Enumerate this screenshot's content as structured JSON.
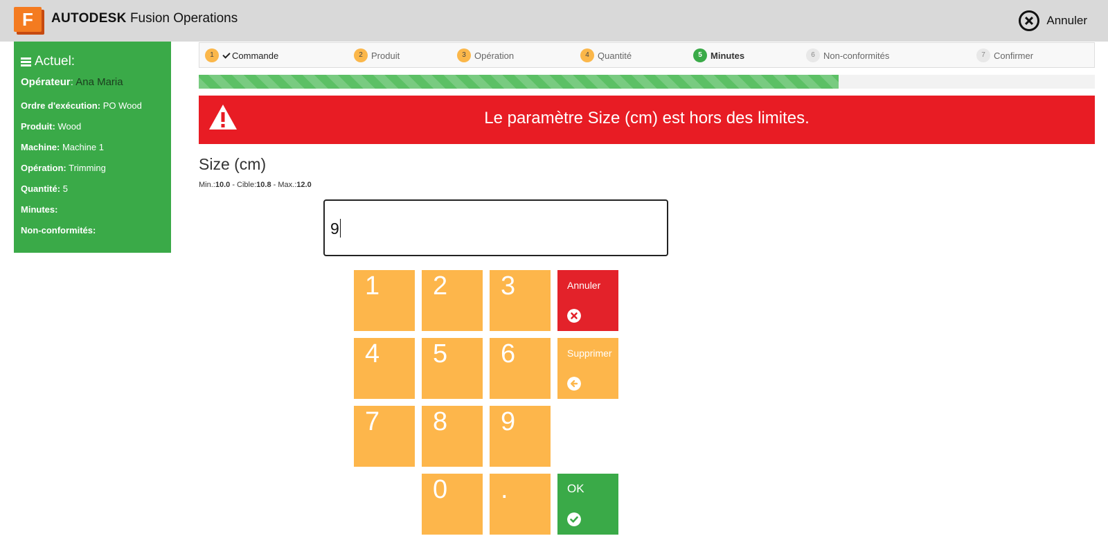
{
  "header": {
    "logo_letter": "F",
    "brand_bold": "AUTODESK",
    "brand_rest": "Fusion Operations",
    "cancel_label": "Annuler",
    "colors": {
      "background": "#d9d9d9",
      "logo": "#f47b20"
    }
  },
  "sidebar": {
    "title": "Actuel:",
    "operator_label": "Opérateur",
    "operator_value": "Ana Maria",
    "rows": [
      {
        "label": "Ordre d'exécution:",
        "value": "PO Wood"
      },
      {
        "label": "Produit:",
        "value": "Wood"
      },
      {
        "label": "Machine:",
        "value": "Machine 1"
      },
      {
        "label": "Opération:",
        "value": "Trimming"
      },
      {
        "label": "Quantité:",
        "value": "5"
      },
      {
        "label": "Minutes:",
        "value": ""
      },
      {
        "label": "Non-conformités:",
        "value": ""
      }
    ],
    "color": "#3aaa48"
  },
  "steps": [
    {
      "num": "1",
      "label": "Commande",
      "state": "done"
    },
    {
      "num": "2",
      "label": "Produit",
      "state": "pending"
    },
    {
      "num": "3",
      "label": "Opération",
      "state": "pending"
    },
    {
      "num": "4",
      "label": "Quantité",
      "state": "pending"
    },
    {
      "num": "5",
      "label": "Minutes",
      "state": "active"
    },
    {
      "num": "6",
      "label": "Non-conformités",
      "state": "upcoming"
    },
    {
      "num": "7",
      "label": "Confirmer",
      "state": "upcoming"
    }
  ],
  "progress_fraction": 0.714,
  "alert": {
    "message": "Le paramètre Size (cm) est hors des limites.",
    "color": "#e81c24"
  },
  "parameter": {
    "name": "Size (cm)",
    "min_label": "Min.:",
    "min": "10.0",
    "target_label": "Cible:",
    "target": "10.8",
    "max_label": "Max.:",
    "max": "12.0",
    "separator": " - ",
    "current_value": "9"
  },
  "keypad": {
    "digits": [
      "1",
      "2",
      "3",
      "4",
      "5",
      "6",
      "7",
      "8",
      "9",
      "0",
      "."
    ],
    "cancel_label": "Annuler",
    "delete_label": "Supprimer",
    "ok_label": "OK",
    "colors": {
      "digit": "#fdb64b",
      "cancel": "#e3222a",
      "ok": "#3aaa48"
    }
  }
}
